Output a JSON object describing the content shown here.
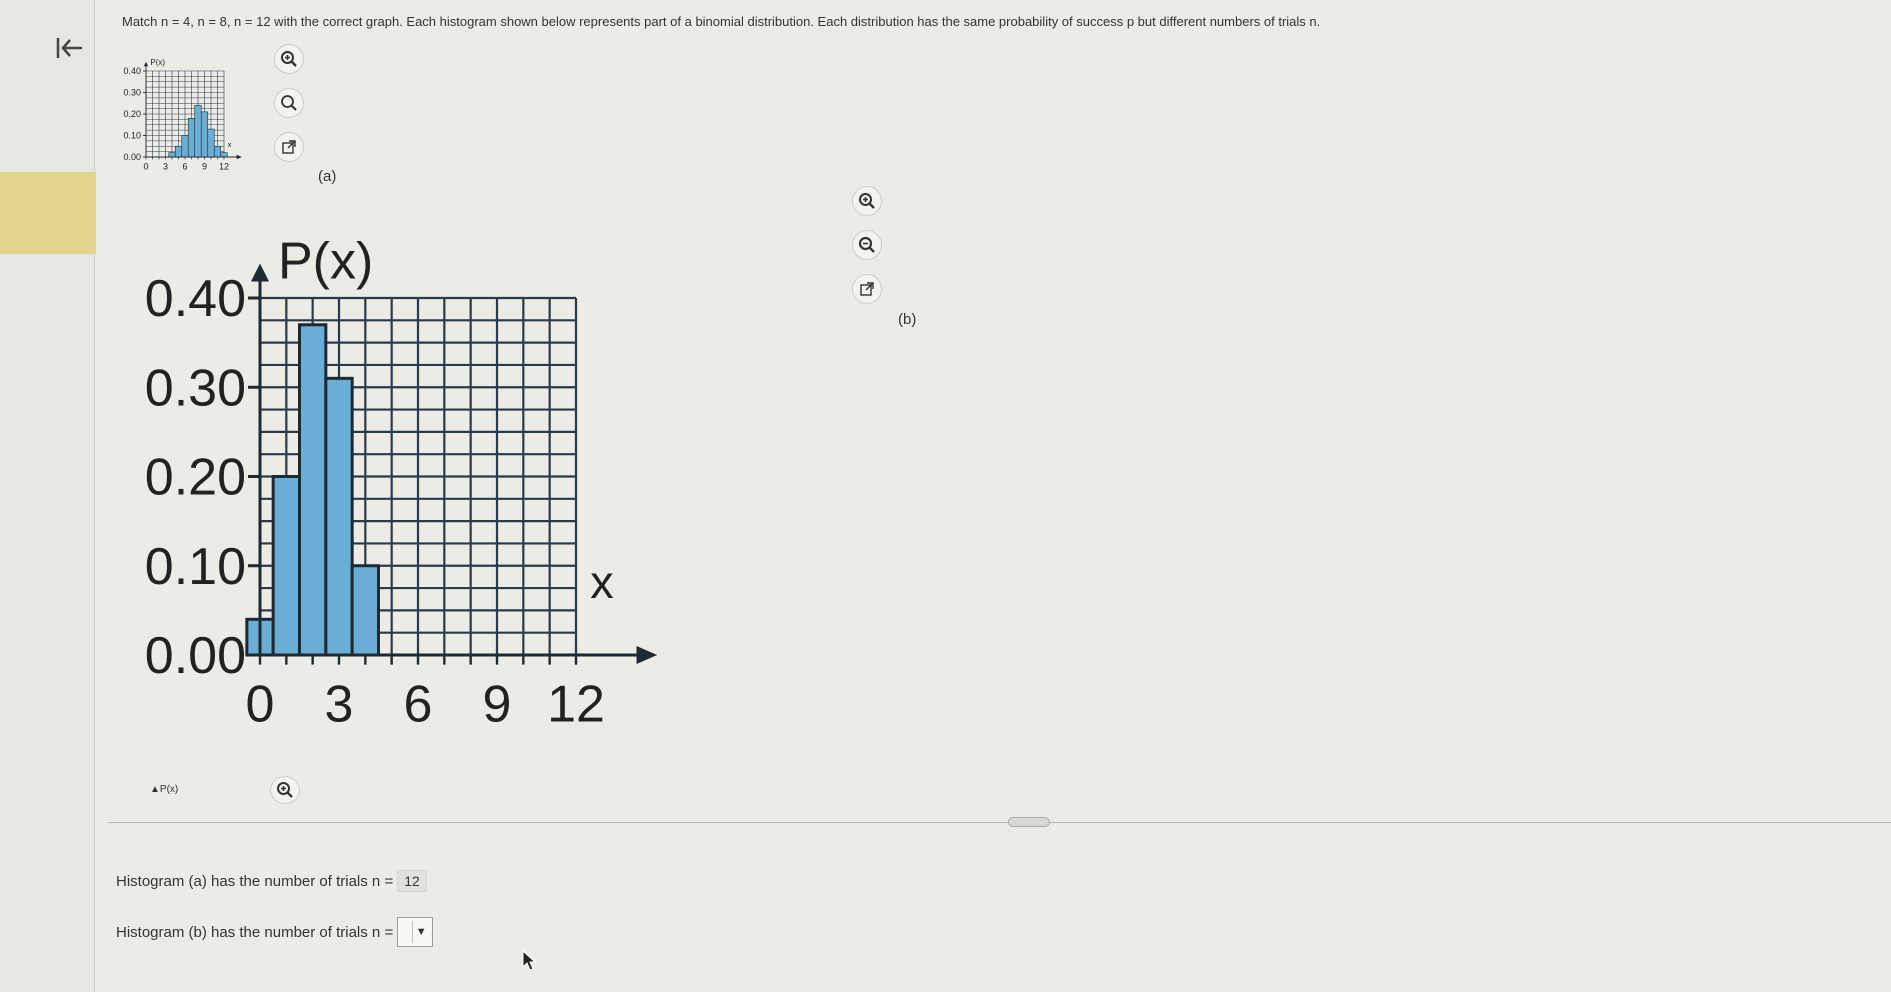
{
  "nav": {
    "back_icon": "collapse-left-icon"
  },
  "question": {
    "prefix": "Match ",
    "n_values": [
      "n = 4",
      "n = 8",
      "n = 12"
    ],
    "suffix": " with the correct graph. Each histogram shown below represents part of a binomial distribution. Each distribution has the same probability of success p but different numbers of trials n."
  },
  "figure_a": {
    "label": "(a)",
    "axis_label": "P(x)",
    "x_label": "x"
  },
  "figure_b": {
    "label": "(b)",
    "axis_label": "P(x)",
    "x_label": "x"
  },
  "figure_c": {
    "axis_label": "P(x)"
  },
  "icons": {
    "zoom_in": "zoom-in-icon",
    "zoom_out": "zoom-out-icon",
    "popout": "popout-icon"
  },
  "answers": {
    "a_text": "Histogram (a) has the number of trials n =",
    "a_value": "12",
    "b_text": "Histogram (b) has the number of trials n =",
    "b_value": ""
  },
  "colors": {
    "bar_fill": "#6aaed6",
    "bar_stroke": "#1e2a33",
    "grid": "#2a3a4a",
    "accent": "#e3d48c"
  },
  "chart_data": [
    {
      "type": "bar",
      "x": [
        0,
        1,
        2,
        3,
        4,
        5,
        6,
        7,
        8,
        9,
        10,
        11,
        12
      ],
      "values": [
        0.0,
        0.0,
        0.0,
        0.0,
        0.02,
        0.05,
        0.1,
        0.18,
        0.24,
        0.21,
        0.13,
        0.05,
        0.02
      ],
      "title": "",
      "xlabel": "x",
      "ylabel": "P(x)",
      "ylim": [
        0,
        0.4
      ],
      "yticks": [
        "0.00",
        "0.10",
        "0.20",
        "0.30",
        "0.40"
      ],
      "xticks": [
        "0",
        "3",
        "6",
        "9",
        "12"
      ],
      "grid": true
    },
    {
      "type": "bar",
      "x": [
        0,
        1,
        2,
        3,
        4
      ],
      "values": [
        0.04,
        0.2,
        0.37,
        0.31,
        0.1
      ],
      "title": "",
      "xlabel": "x",
      "ylabel": "P(x)",
      "ylim": [
        0,
        0.4
      ],
      "yticks": [
        "0.00",
        "0.10",
        "0.20",
        "0.30",
        "0.40"
      ],
      "xticks": [
        "0",
        "3",
        "6",
        "9",
        "12"
      ],
      "grid": true
    }
  ]
}
